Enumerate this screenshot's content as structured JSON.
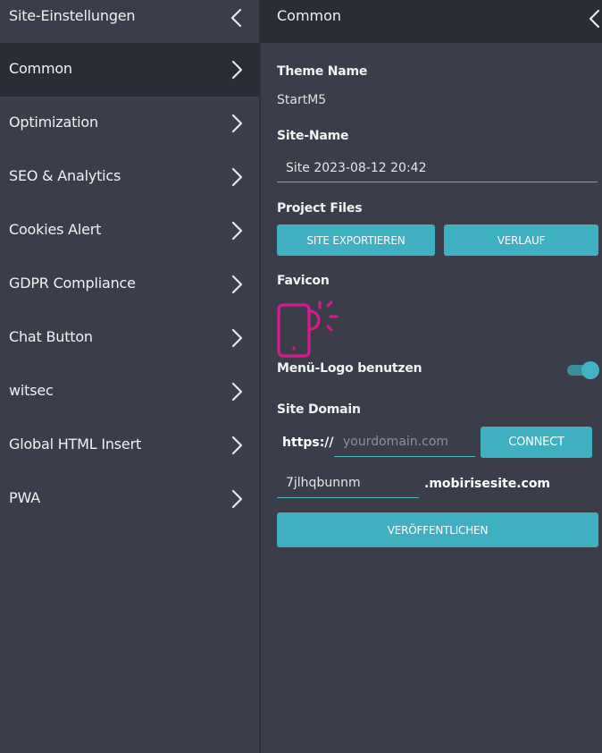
{
  "left_panel": {
    "title": "Site-Einstellungen",
    "items": [
      {
        "label": "Common",
        "active": true
      },
      {
        "label": "Optimization",
        "active": false
      },
      {
        "label": "SEO & Analytics",
        "active": false
      },
      {
        "label": "Cookies Alert",
        "active": false
      },
      {
        "label": "GDPR Compliance",
        "active": false
      },
      {
        "label": "Chat Button",
        "active": false
      },
      {
        "label": "witsec",
        "active": false
      },
      {
        "label": "Global HTML Insert",
        "active": false
      },
      {
        "label": "PWA",
        "active": false
      }
    ]
  },
  "right_panel": {
    "title": "Common",
    "theme_name": {
      "label": "Theme Name",
      "value": "StartM5"
    },
    "site_name": {
      "label": "Site-Name",
      "value": "Site 2023-08-12 20:42"
    },
    "project_files": {
      "label": "Project Files",
      "export_label": "SITE EXPORTIEREN",
      "history_label": "VERLAUF"
    },
    "favicon": {
      "label": "Favicon",
      "icon": "phone-sun-icon"
    },
    "menu_logo": {
      "label": "Menü-Logo benutzen",
      "enabled": true
    },
    "site_domain": {
      "label": "Site Domain",
      "protocol": "https://",
      "domain_placeholder": "yourdomain.com",
      "connect_label": "CONNECT",
      "subdomain_value": "7jlhqbunnm",
      "suffix": ".mobirisesite.com",
      "publish_label": "VERÖFFENTLICHEN"
    }
  },
  "colors": {
    "accent": "#3fb0bf",
    "panel_bg": "#3b3e4a",
    "header_bg": "#2a2d36",
    "favicon_magenta": "#d81b8c"
  }
}
